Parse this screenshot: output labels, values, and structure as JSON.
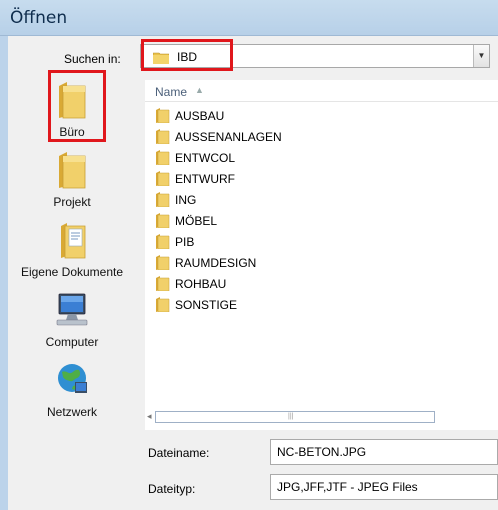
{
  "window": {
    "title": "Öffnen"
  },
  "look_in": {
    "label": "Suchen in:",
    "value": "IBD"
  },
  "places": [
    {
      "label": "Büro",
      "icon": "folder-icon"
    },
    {
      "label": "Projekt",
      "icon": "folder-icon"
    },
    {
      "label": "Eigene Dokumente",
      "icon": "documents-icon"
    },
    {
      "label": "Computer",
      "icon": "computer-icon"
    },
    {
      "label": "Netzwerk",
      "icon": "network-icon"
    }
  ],
  "file_list": {
    "column_name": "Name",
    "items": [
      "AUSBAU",
      "AUSSENANLAGEN",
      "ENTWCOL",
      "ENTWURF",
      "ING",
      "MÖBEL",
      "PIB",
      "RAUMDESIGN",
      "ROHBAU",
      "SONSTIGE"
    ]
  },
  "filename": {
    "label": "Dateiname:",
    "value": "NC-BETON.JPG"
  },
  "filetype": {
    "label": "Dateityp:",
    "value": "JPG,JFF,JTF - JPEG Files"
  },
  "colors": {
    "highlight_box": "#e0171c",
    "folder": "#e8c14a",
    "title_bar": "#c7dcee"
  }
}
